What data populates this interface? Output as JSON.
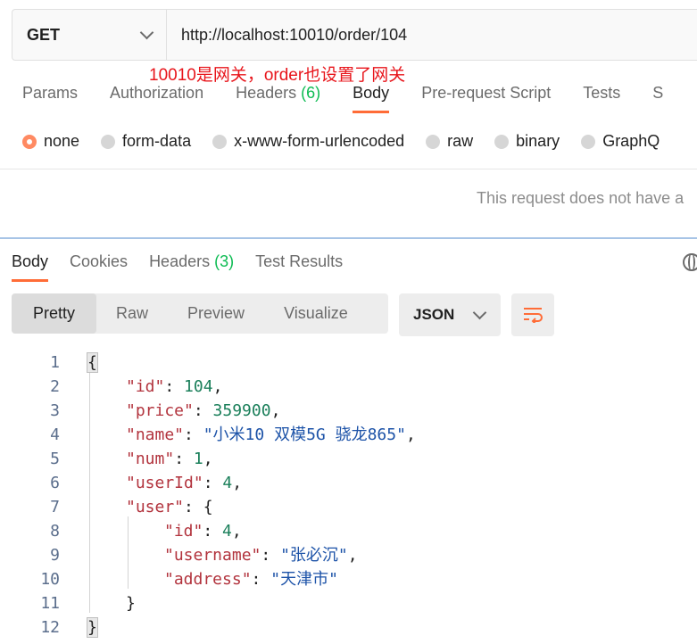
{
  "request": {
    "method": "GET",
    "url": "http://localhost:10010/order/104"
  },
  "annotation": "10010是网关，order也设置了网关",
  "request_tabs": [
    {
      "label": "Params",
      "count": ""
    },
    {
      "label": "Authorization",
      "count": ""
    },
    {
      "label": "Headers",
      "count": "(6)"
    },
    {
      "label": "Body",
      "count": "",
      "active": true
    },
    {
      "label": "Pre-request Script",
      "count": ""
    },
    {
      "label": "Tests",
      "count": ""
    },
    {
      "label": "S",
      "count": ""
    }
  ],
  "body_types": [
    "none",
    "form-data",
    "x-www-form-urlencoded",
    "raw",
    "binary",
    "GraphQ"
  ],
  "body_selected": "none",
  "no_body_text": "This request does not have a",
  "response_tabs": [
    {
      "label": "Body",
      "count": "",
      "active": true
    },
    {
      "label": "Cookies",
      "count": ""
    },
    {
      "label": "Headers",
      "count": "(3)"
    },
    {
      "label": "Test Results",
      "count": ""
    }
  ],
  "view_modes": [
    "Pretty",
    "Raw",
    "Preview",
    "Visualize"
  ],
  "view_selected": "Pretty",
  "format": "JSON",
  "icons": {
    "format_chevron": "chevron-down-icon",
    "wrap": "wrap-lines-icon",
    "globe": "globe-icon"
  },
  "colors": {
    "accent": "#ff6c37",
    "count": "#0cbb52",
    "annotation": "#e8151b"
  },
  "code_lines": [
    {
      "num": "1",
      "indent": 0,
      "tokens": [
        {
          "t": "p",
          "v": "{"
        }
      ]
    },
    {
      "num": "2",
      "indent": 1,
      "tokens": [
        {
          "t": "k",
          "v": "\"id\""
        },
        {
          "t": "p",
          "v": ": "
        },
        {
          "t": "n",
          "v": "104"
        },
        {
          "t": "p",
          "v": ","
        }
      ]
    },
    {
      "num": "3",
      "indent": 1,
      "tokens": [
        {
          "t": "k",
          "v": "\"price\""
        },
        {
          "t": "p",
          "v": ": "
        },
        {
          "t": "n",
          "v": "359900"
        },
        {
          "t": "p",
          "v": ","
        }
      ]
    },
    {
      "num": "4",
      "indent": 1,
      "tokens": [
        {
          "t": "k",
          "v": "\"name\""
        },
        {
          "t": "p",
          "v": ": "
        },
        {
          "t": "s",
          "v": "\"小米10 双模5G 骁龙865\""
        },
        {
          "t": "p",
          "v": ","
        }
      ]
    },
    {
      "num": "5",
      "indent": 1,
      "tokens": [
        {
          "t": "k",
          "v": "\"num\""
        },
        {
          "t": "p",
          "v": ": "
        },
        {
          "t": "n",
          "v": "1"
        },
        {
          "t": "p",
          "v": ","
        }
      ]
    },
    {
      "num": "6",
      "indent": 1,
      "tokens": [
        {
          "t": "k",
          "v": "\"userId\""
        },
        {
          "t": "p",
          "v": ": "
        },
        {
          "t": "n",
          "v": "4"
        },
        {
          "t": "p",
          "v": ","
        }
      ]
    },
    {
      "num": "7",
      "indent": 1,
      "tokens": [
        {
          "t": "k",
          "v": "\"user\""
        },
        {
          "t": "p",
          "v": ": {"
        }
      ]
    },
    {
      "num": "8",
      "indent": 2,
      "tokens": [
        {
          "t": "k",
          "v": "\"id\""
        },
        {
          "t": "p",
          "v": ": "
        },
        {
          "t": "n",
          "v": "4"
        },
        {
          "t": "p",
          "v": ","
        }
      ]
    },
    {
      "num": "9",
      "indent": 2,
      "tokens": [
        {
          "t": "k",
          "v": "\"username\""
        },
        {
          "t": "p",
          "v": ": "
        },
        {
          "t": "s",
          "v": "\"张必沉\""
        },
        {
          "t": "p",
          "v": ","
        }
      ]
    },
    {
      "num": "10",
      "indent": 2,
      "tokens": [
        {
          "t": "k",
          "v": "\"address\""
        },
        {
          "t": "p",
          "v": ": "
        },
        {
          "t": "s",
          "v": "\"天津市\""
        }
      ]
    },
    {
      "num": "11",
      "indent": 1,
      "tokens": [
        {
          "t": "p",
          "v": "}"
        }
      ]
    },
    {
      "num": "12",
      "indent": 0,
      "tokens": [
        {
          "t": "p",
          "v": "}"
        }
      ]
    }
  ]
}
